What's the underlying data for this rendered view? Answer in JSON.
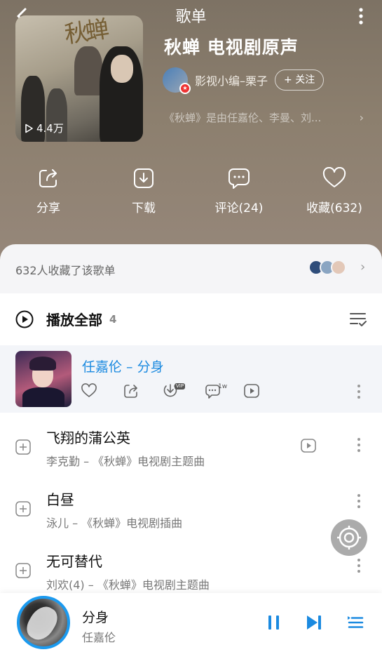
{
  "header": {
    "title": "歌单"
  },
  "playlist": {
    "title": "秋蝉 电视剧原声",
    "play_count": "4.4万",
    "cover_text": "秋蝉",
    "creator": "影视小编–栗子",
    "follow_label": "+ 关注",
    "description": "《秋蝉》是由任嘉伦、李曼、刘..."
  },
  "actions": {
    "share": "分享",
    "download": "下载",
    "comment": "评论(24)",
    "favorite": "收藏(632)"
  },
  "favorites": {
    "text": "632人收藏了该歌单"
  },
  "list": {
    "play_all_label": "播放全部",
    "count": "4",
    "current": {
      "title": "任嘉伦 – 分身",
      "comment_count": "1w",
      "vip": "VIP"
    },
    "songs": [
      {
        "title": "飞翔的蒲公英",
        "subtitle": "李克勤 – 《秋蝉》电视剧主题曲"
      },
      {
        "title": "白昼",
        "subtitle": "泳儿 – 《秋蝉》电视剧插曲"
      },
      {
        "title": "无可替代",
        "subtitle": "刘欢(4) – 《秋蝉》电视剧主题曲"
      }
    ]
  },
  "player": {
    "title": "分身",
    "artist": "任嘉伦"
  },
  "colors": {
    "accent": "#1b8ae0",
    "hero": "#8a7c6b"
  }
}
